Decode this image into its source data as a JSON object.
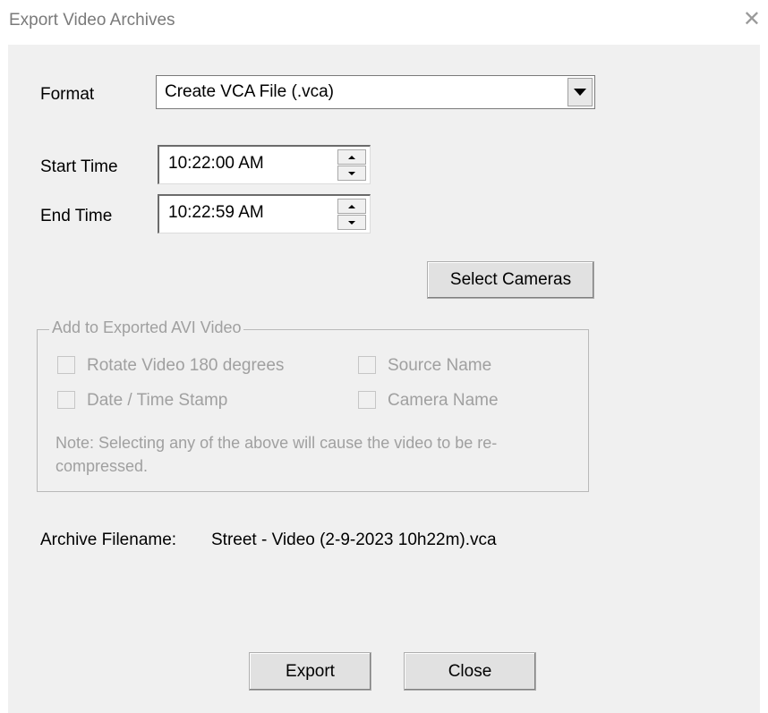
{
  "window": {
    "title": "Export Video Archives",
    "close_glyph": "✕"
  },
  "format": {
    "label": "Format",
    "selected": "Create VCA File (.vca)"
  },
  "start_time": {
    "label": "Start Time",
    "value": "10:22:00 AM"
  },
  "end_time": {
    "label": "End Time",
    "value": "10:22:59 AM"
  },
  "select_cameras_label": "Select Cameras",
  "avi_group": {
    "legend": "Add to Exported AVI Video",
    "rotate": "Rotate Video 180 degrees",
    "source_name": "Source Name",
    "datetime_stamp": "Date / Time Stamp",
    "camera_name": "Camera Name",
    "note": "Note: Selecting any of the above will cause the video to be re-compressed."
  },
  "archive": {
    "label": "Archive Filename:",
    "filename": "Street - Video (2-9-2023 10h22m).vca"
  },
  "buttons": {
    "export": "Export",
    "close": "Close"
  }
}
